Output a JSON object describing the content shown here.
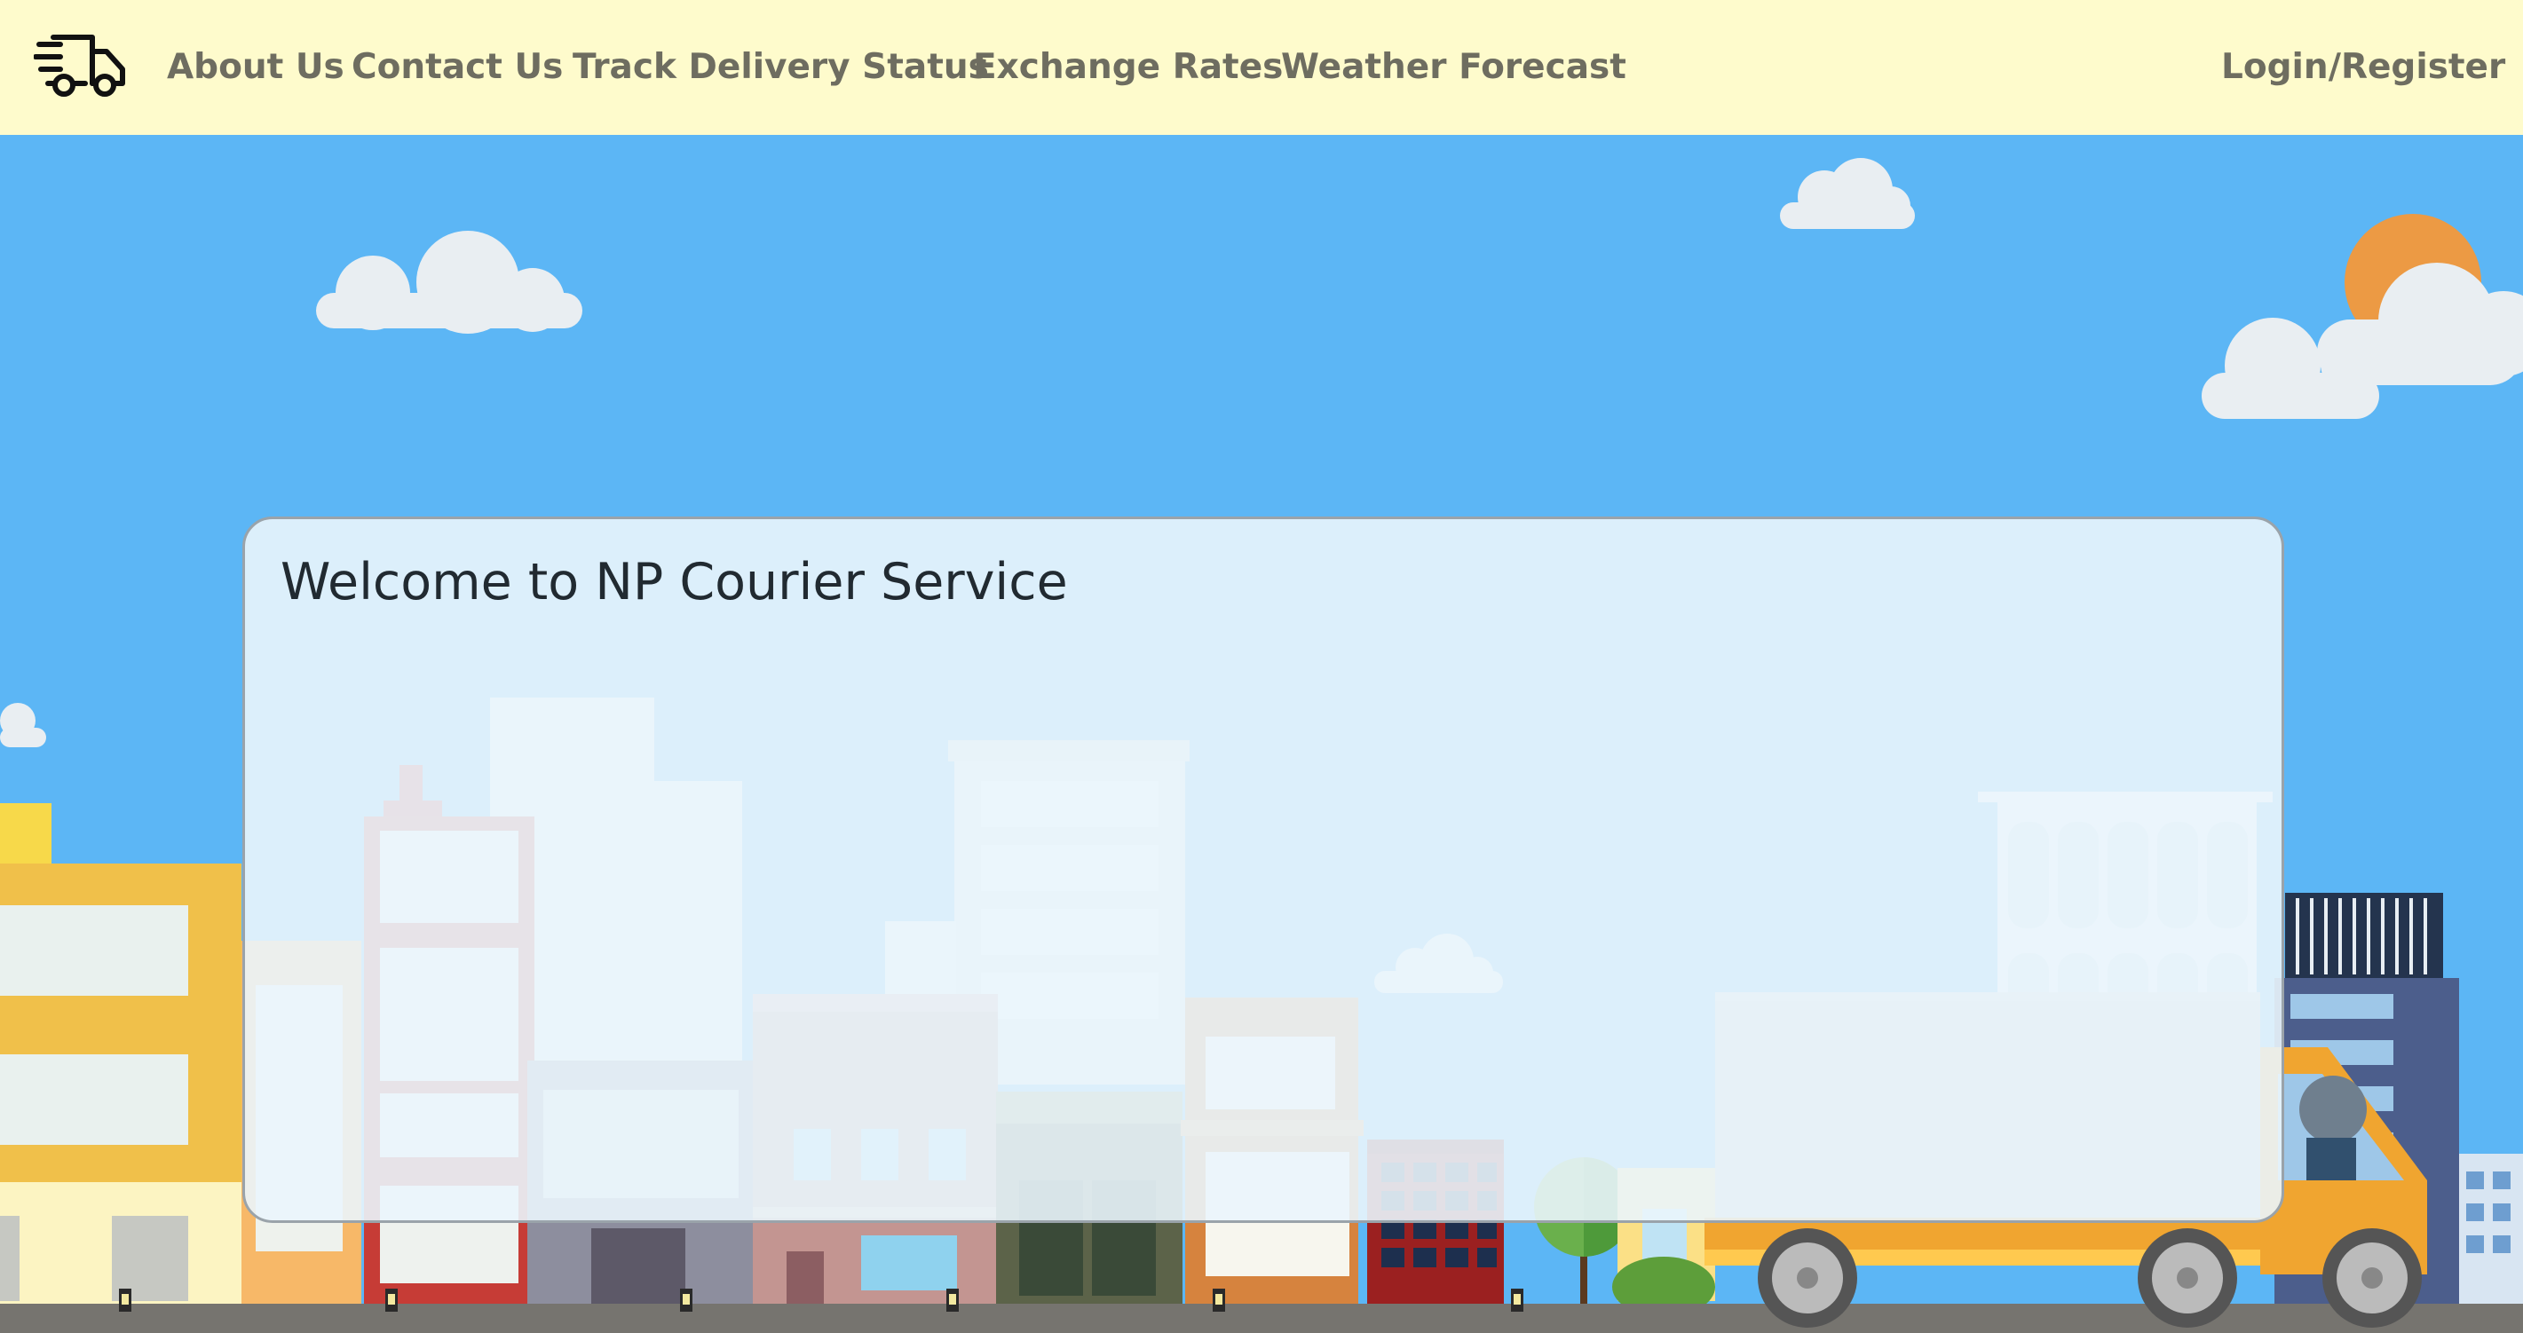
{
  "navbar": {
    "logo_icon": "delivery-truck-icon",
    "links": [
      {
        "label": "About Us"
      },
      {
        "label": "Contact Us"
      },
      {
        "label": "Track Delivery Status"
      },
      {
        "label": "Exchange Rates"
      },
      {
        "label": "Weather Forecast"
      }
    ],
    "login_label": "Login/Register"
  },
  "hero": {
    "welcome_title": "Welcome to NP Courier Service"
  },
  "colors": {
    "navbar_bg": "#fefbcc",
    "nav_text": "#6e6d60",
    "sky": "#5cb6f5",
    "card_bg": "#eaf5fc",
    "truck": "#f0a530"
  }
}
